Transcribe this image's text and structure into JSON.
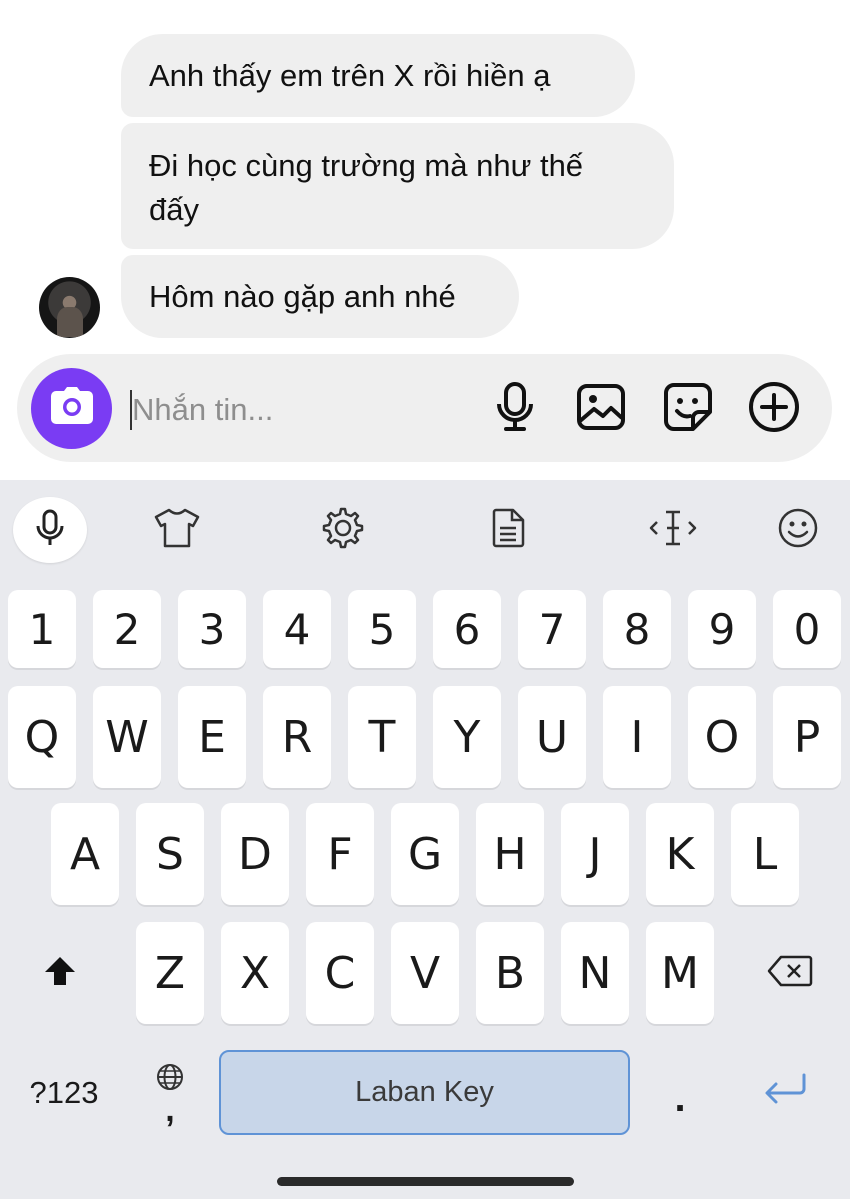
{
  "chat": {
    "messages": [
      {
        "text": "Anh thấy em trên X rồi hiền ạ"
      },
      {
        "text": "Đi học cùng trường mà như thế đấy"
      },
      {
        "text": "Hôm nào gặp anh nhé"
      }
    ]
  },
  "composer": {
    "placeholder": "Nhắn tin...",
    "camera_color": "#7a3cf3",
    "icons": [
      "camera-icon",
      "microphone-icon",
      "gallery-icon",
      "sticker-icon",
      "add-icon"
    ]
  },
  "keyboard": {
    "toolbar_icons": [
      "microphone-icon",
      "shirt-icon",
      "gear-icon",
      "clipboard-icon",
      "cursor-icon",
      "emoji-icon"
    ],
    "number_row": [
      "1",
      "2",
      "3",
      "4",
      "5",
      "6",
      "7",
      "8",
      "9",
      "0"
    ],
    "row1": [
      "Q",
      "W",
      "E",
      "R",
      "T",
      "Y",
      "U",
      "I",
      "O",
      "P"
    ],
    "row2": [
      "A",
      "S",
      "D",
      "F",
      "G",
      "H",
      "J",
      "K",
      "L"
    ],
    "row3": [
      "Z",
      "X",
      "C",
      "V",
      "B",
      "N",
      "M"
    ],
    "symbols_label": "?123",
    "comma_label": ",",
    "space_label": "Laban Key",
    "period_label": ".",
    "accent_color": "#5f93d6"
  }
}
